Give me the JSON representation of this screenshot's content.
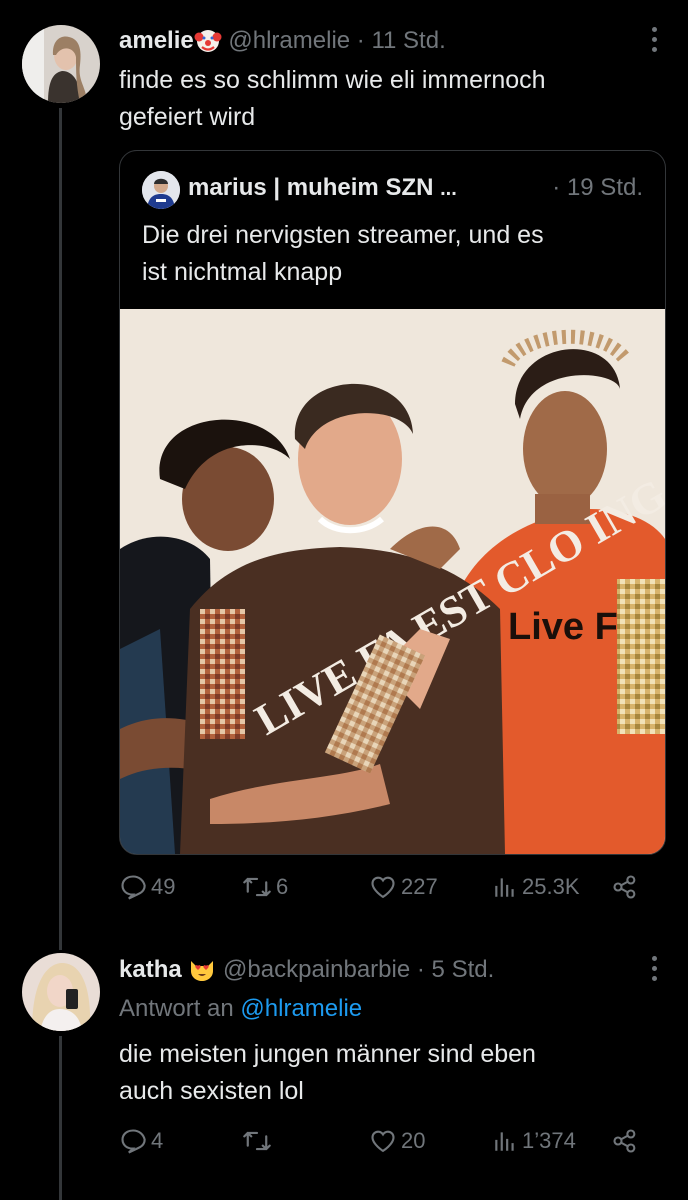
{
  "tweet1": {
    "name": "amelie",
    "name_emoji": "clown-face-emoji",
    "handle": "@hlramelie",
    "dot": "·",
    "time": "11 Std.",
    "text_line1": "finde es so schlimm wie eli immernoch",
    "text_line2": "gefeiert wird",
    "quote": {
      "name": "marius | muheim SZN",
      "ellipsis": "...",
      "time": "· 19 Std.",
      "text_line1": "Die drei nervigsten streamer, und es",
      "text_line2": "ist nichtmal knapp",
      "image": {
        "shirt_text_brown": "LIVE FA  EST  CLO  ING",
        "shirt_text_orange": "Live F"
      }
    },
    "actions": {
      "reply": "49",
      "retweet": "6",
      "like": "227",
      "views": "25.3K"
    }
  },
  "tweet2": {
    "name": "katha",
    "name_emoji": "smiling-cat-heart-eyes-emoji",
    "handle": "@backpainbarbie",
    "dot": "·",
    "time": "5 Std.",
    "reply_prefix": "Antwort an",
    "reply_to": "@hlramelie",
    "text_line1": "die meisten jungen männer sind eben",
    "text_line2": "auch sexisten lol",
    "actions": {
      "reply": "4",
      "retweet": "",
      "like": "20",
      "views": "1’374"
    }
  },
  "colors": {
    "background": "#000000",
    "text": "#e7e9ea",
    "muted": "#71767b",
    "link": "#1d9bf0",
    "border": "#333639"
  }
}
